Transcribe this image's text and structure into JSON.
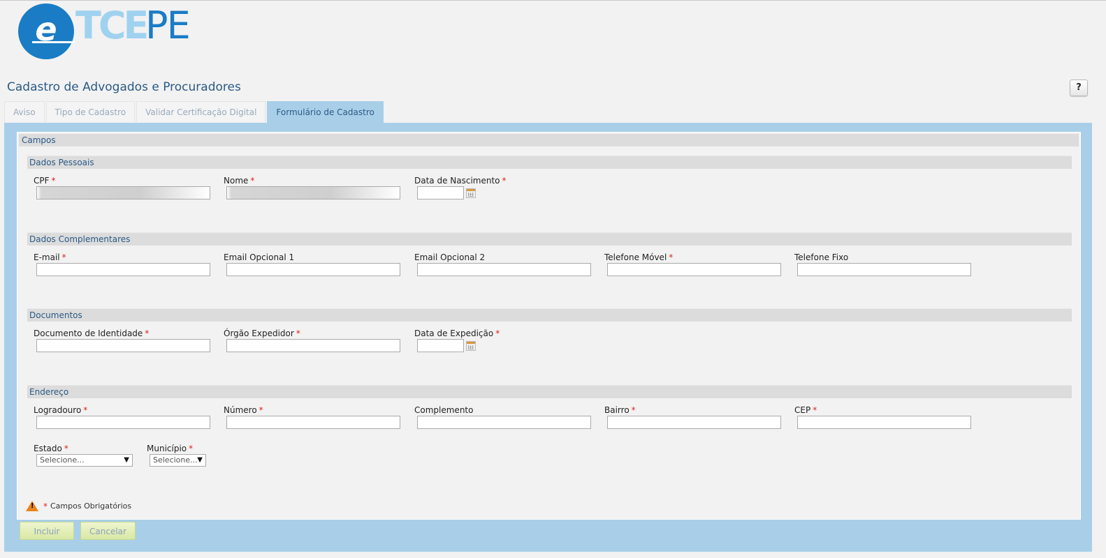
{
  "logo": {
    "mark": "e",
    "text_light": "TCE",
    "text_dark": "PE"
  },
  "page_title": "Cadastro de Advogados e Procuradores",
  "help_label": "?",
  "tabs": [
    {
      "label": "Aviso"
    },
    {
      "label": "Tipo de Cadastro"
    },
    {
      "label": "Validar Certificação Digital"
    },
    {
      "label": "Formulário de Cadastro",
      "active": true
    }
  ],
  "form": {
    "campos_label": "Campos",
    "required_mark": "*",
    "sections": {
      "dados_pessoais": {
        "title": "Dados Pessoais",
        "cpf": {
          "label": "CPF",
          "value": ""
        },
        "nome": {
          "label": "Nome",
          "value": ""
        },
        "data_nascimento": {
          "label": "Data de Nascimento",
          "value": ""
        }
      },
      "dados_complementares": {
        "title": "Dados Complementares",
        "email": {
          "label": "E-mail",
          "value": ""
        },
        "email_opcional_1": {
          "label": "Email Opcional 1",
          "value": ""
        },
        "email_opcional_2": {
          "label": "Email Opcional 2",
          "value": ""
        },
        "telefone_movel": {
          "label": "Telefone Móvel",
          "value": ""
        },
        "telefone_fixo": {
          "label": "Telefone Fixo",
          "value": ""
        }
      },
      "documentos": {
        "title": "Documentos",
        "documento_identidade": {
          "label": "Documento de Identidade",
          "value": ""
        },
        "orgao_expedidor": {
          "label": "Órgão Expedidor",
          "value": ""
        },
        "data_expedicao": {
          "label": "Data de Expedição",
          "value": ""
        }
      },
      "endereco": {
        "title": "Endereço",
        "logradouro": {
          "label": "Logradouro",
          "value": ""
        },
        "numero": {
          "label": "Número",
          "value": ""
        },
        "complemento": {
          "label": "Complemento",
          "value": ""
        },
        "bairro": {
          "label": "Bairro",
          "value": ""
        },
        "cep": {
          "label": "CEP",
          "value": ""
        },
        "estado": {
          "label": "Estado",
          "selected": "Selecione..."
        },
        "municipio": {
          "label": "Município",
          "selected": "Selecione..."
        }
      }
    },
    "footnote": "Campos Obrigatórios"
  },
  "buttons": {
    "incluir": "Incluir",
    "cancelar": "Cancelar"
  },
  "colors": {
    "accent_blue": "#1a7cc4",
    "panel_blue": "#a9cfe8",
    "title_blue": "#2a5a85",
    "required_red": "#d22222",
    "button_green": "#d9e8a4"
  }
}
